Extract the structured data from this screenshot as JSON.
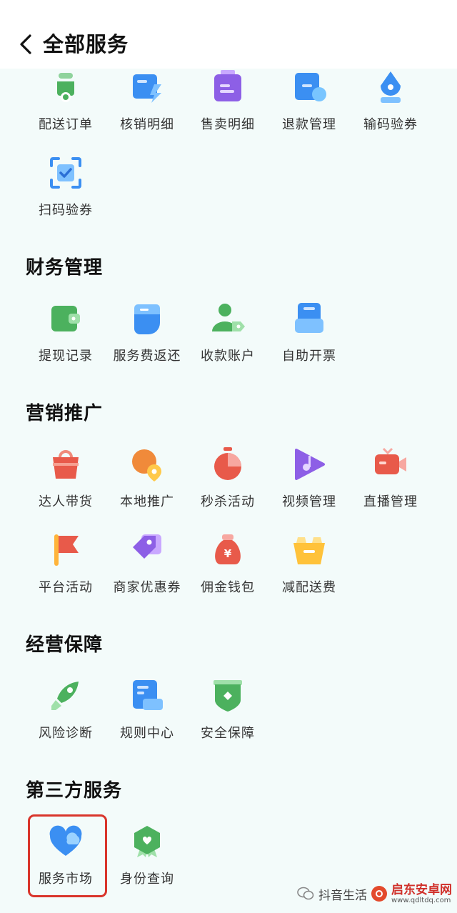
{
  "header": {
    "title": "全部服务"
  },
  "top_items": [
    {
      "label": "配送订单",
      "icon": "scooter-icon"
    },
    {
      "label": "核销明细",
      "icon": "verify-detail-icon"
    },
    {
      "label": "售卖明细",
      "icon": "sales-detail-icon"
    },
    {
      "label": "退款管理",
      "icon": "refund-icon"
    },
    {
      "label": "输码验券",
      "icon": "pen-code-icon"
    },
    {
      "label": "扫码验券",
      "icon": "scan-code-icon"
    }
  ],
  "sections": [
    {
      "title": "财务管理",
      "items": [
        {
          "label": "提现记录",
          "icon": "wallet-icon"
        },
        {
          "label": "服务费返还",
          "icon": "fee-return-icon"
        },
        {
          "label": "收款账户",
          "icon": "account-icon"
        },
        {
          "label": "自助开票",
          "icon": "invoice-icon"
        }
      ]
    },
    {
      "title": "营销推广",
      "items": [
        {
          "label": "达人带货",
          "icon": "shopping-bag-icon"
        },
        {
          "label": "本地推广",
          "icon": "location-icon"
        },
        {
          "label": "秒杀活动",
          "icon": "timer-icon"
        },
        {
          "label": "视频管理",
          "icon": "video-icon"
        },
        {
          "label": "直播管理",
          "icon": "camera-icon"
        },
        {
          "label": "平台活动",
          "icon": "flag-icon"
        },
        {
          "label": "商家优惠券",
          "icon": "coupon-tag-icon"
        },
        {
          "label": "佣金钱包",
          "icon": "money-bag-icon"
        },
        {
          "label": "减配送费",
          "icon": "basket-icon"
        }
      ]
    },
    {
      "title": "经营保障",
      "items": [
        {
          "label": "风险诊断",
          "icon": "rocket-icon"
        },
        {
          "label": "规则中心",
          "icon": "document-icon"
        },
        {
          "label": "安全保障",
          "icon": "shield-icon"
        }
      ]
    },
    {
      "title": "第三方服务",
      "items": [
        {
          "label": "服务市场",
          "icon": "heart-icon"
        },
        {
          "label": "身份查询",
          "icon": "hexagon-icon"
        }
      ]
    }
  ],
  "watermark": {
    "account": "抖音生活",
    "site_name": "启东安卓网",
    "site_url": "www.qdltdq.com"
  },
  "colors": {
    "highlight": "#d9352b",
    "background": "#f3fbfa"
  }
}
